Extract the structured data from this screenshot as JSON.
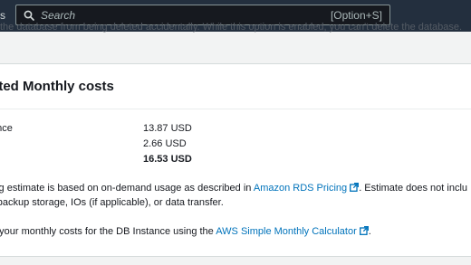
{
  "topbar": {
    "crumb_fragment": "s",
    "search_placeholder": "Search",
    "search_shortcut": "[Option+S]"
  },
  "warning_fragment": "the database from being deleted accidentally. While this option is enabled, you can't delete the database.",
  "panel": {
    "title_fragment": "ated Monthly costs",
    "rows": [
      {
        "label": "ance",
        "value": "13.87 USD"
      },
      {
        "label": "e",
        "value": "2.66 USD"
      },
      {
        "label": "",
        "value": "16.53 USD"
      }
    ],
    "estimate": {
      "line1_prefix": "ing estimate is based on on-demand usage as described in ",
      "line1_link": "Amazon RDS Pricing",
      "line1_suffix": ". Estimate does not inclu",
      "line2": "r backup storage, IOs (if applicable), or data transfer."
    },
    "calculator": {
      "prefix": "e your monthly costs for the DB Instance using the ",
      "link": "AWS Simple Monthly Calculator",
      "suffix": "."
    }
  },
  "icons": {
    "search": "search-icon",
    "external": "external-link-icon"
  },
  "colors": {
    "nav_bg": "#232f3e",
    "link": "#0073bb",
    "page_bg": "#f2f3f3"
  }
}
